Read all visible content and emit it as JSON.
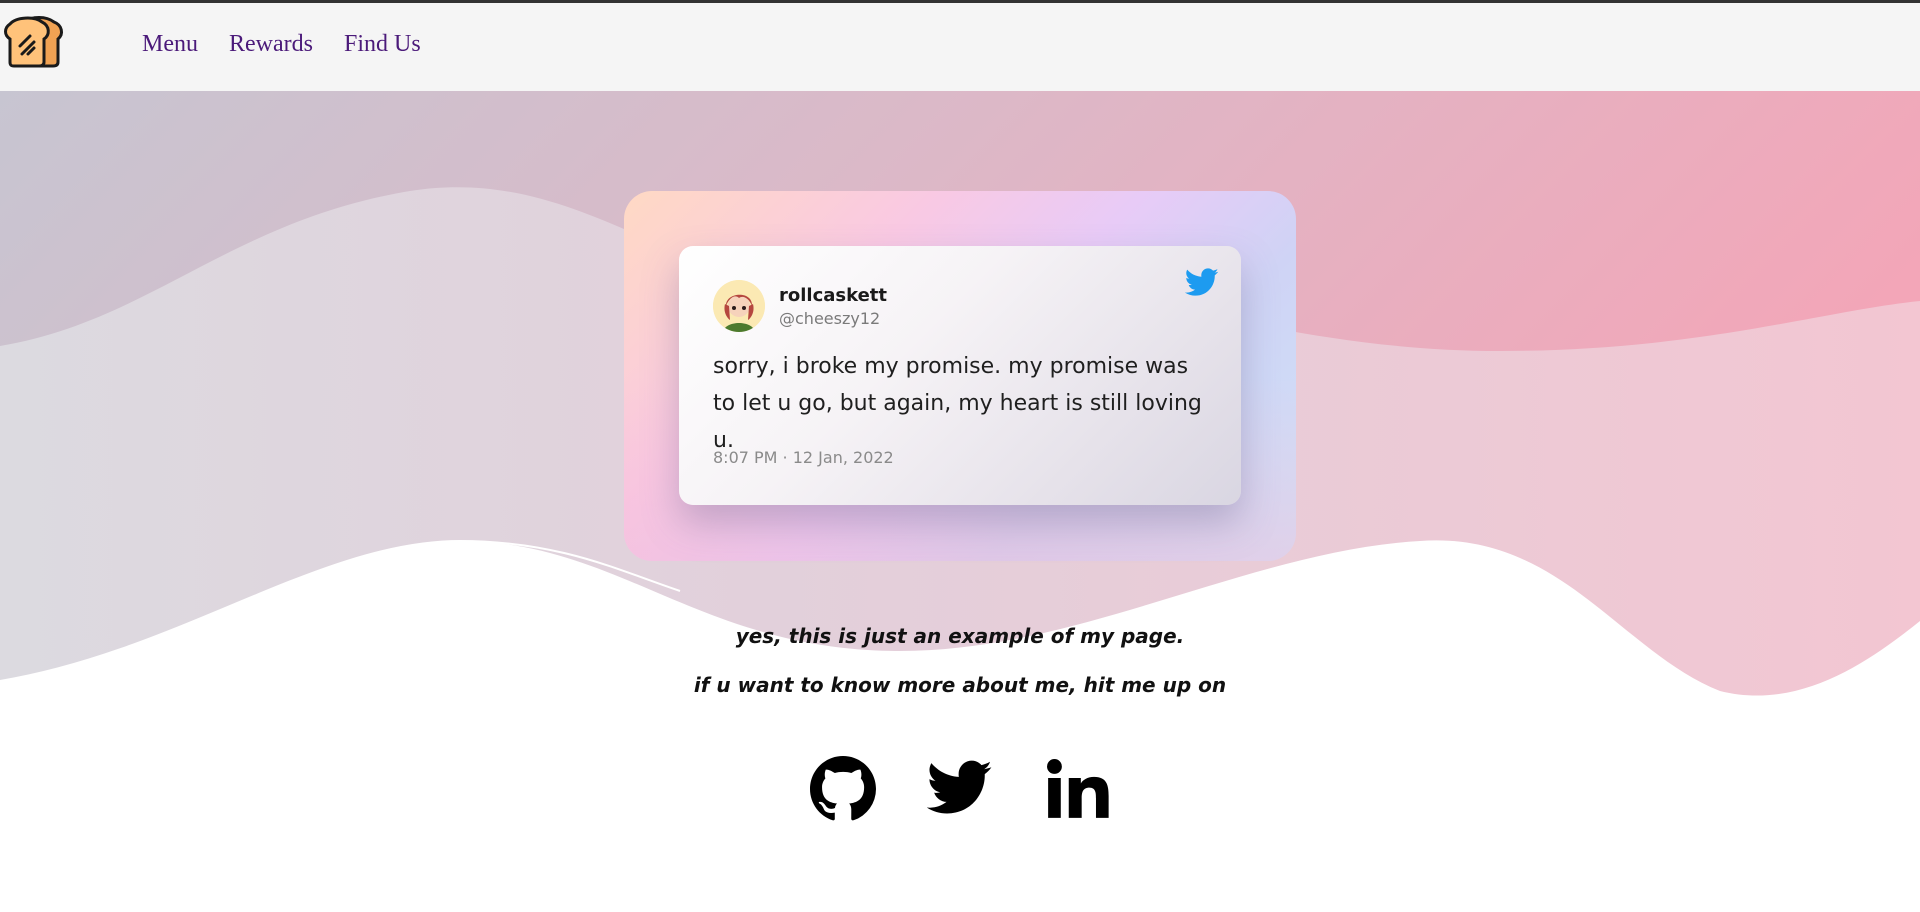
{
  "nav": {
    "logo": "toast-logo",
    "links": [
      "Menu",
      "Rewards",
      "Find Us"
    ]
  },
  "tweet": {
    "display_name": "rollcaskett",
    "handle": "@cheeszy12",
    "text": "sorry, i broke my promise. my promise was to let u go, but again, my heart is still loving u.",
    "timestamp": "8:07 PM · 12 Jan, 2022",
    "icon": "twitter-bird-icon"
  },
  "captions": {
    "line1": "yes, this is just an example of my page.",
    "line2": "if u want to know more about me, hit me up on"
  },
  "socials": [
    "github-icon",
    "twitter-icon",
    "linkedin-icon"
  ],
  "colors": {
    "nav_link": "#4b1a7a",
    "twitter_blue": "#1d9bf0",
    "wave_gray": "#c7c5d1",
    "wave_pink": "#f0a6b8"
  }
}
